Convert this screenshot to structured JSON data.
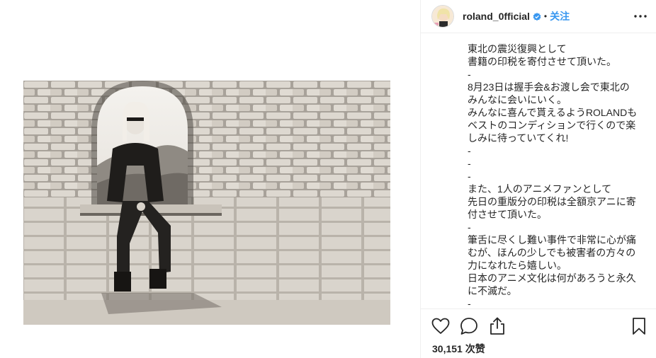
{
  "post": {
    "username": "roland_0fficial",
    "follow_label": "关注",
    "separator": "•",
    "caption_lines": [
      "東北の震災復興として",
      "書籍の印税を寄付させて頂いた。",
      "-",
      "8月23日は握手会&お渡し会で東北の",
      "みんなに会いにいく。",
      "みんなに喜んで貰えるようROLANDも",
      "ベストのコンディションで行くので楽",
      "しみに待っていてくれ!",
      "-",
      "-",
      "-",
      "また、1人のアニメファンとして",
      "先日の重版分の印税は全額京アニに寄",
      "付させて頂いた。",
      "-",
      "筆舌に尽くし難い事件で非常に心が痛",
      "むが、ほんの少しでも被害者の方々の",
      "力になれたら嬉しい。",
      "日本のアニメ文化は何があろうと永久",
      "に不滅だ。",
      "-"
    ],
    "likes_text": "30,151 次赞"
  },
  "icons": {
    "verified": "verified-badge-icon",
    "more": "more-options-icon",
    "like": "heart-icon",
    "comment": "comment-icon",
    "share": "share-icon",
    "save": "bookmark-icon"
  },
  "colors": {
    "accent": "#3897f0",
    "text": "#262626",
    "border": "#efefef"
  }
}
